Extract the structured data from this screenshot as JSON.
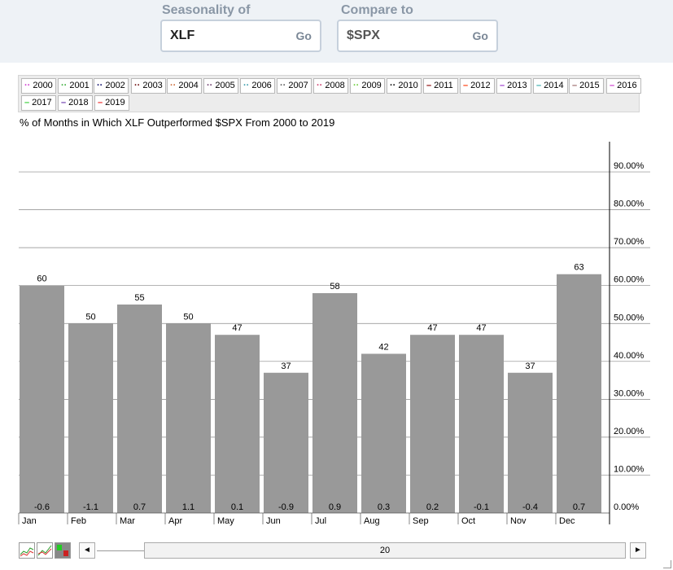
{
  "controls": {
    "seasonality_label": "Seasonality of",
    "seasonality_value": "XLF",
    "compare_label": "Compare to",
    "compare_value": "$SPX",
    "go_label": "Go"
  },
  "legend": [
    {
      "year": "2000",
      "color": "#cc33cc",
      "style": "dotted"
    },
    {
      "year": "2001",
      "color": "#33aa33",
      "style": "dotted"
    },
    {
      "year": "2002",
      "color": "#000066",
      "style": "dotted"
    },
    {
      "year": "2003",
      "color": "#660000",
      "style": "dotted"
    },
    {
      "year": "2004",
      "color": "#cc6633",
      "style": "dotted"
    },
    {
      "year": "2005",
      "color": "#663366",
      "style": "dotted"
    },
    {
      "year": "2006",
      "color": "#3399aa",
      "style": "dotted"
    },
    {
      "year": "2007",
      "color": "#555555",
      "style": "dotted"
    },
    {
      "year": "2008",
      "color": "#cc3366",
      "style": "dotted"
    },
    {
      "year": "2009",
      "color": "#66cc33",
      "style": "dotted"
    },
    {
      "year": "2010",
      "color": "#000000",
      "style": "dotted"
    },
    {
      "year": "2011",
      "color": "#880000",
      "style": "solid"
    },
    {
      "year": "2012",
      "color": "#ff3300",
      "style": "solid"
    },
    {
      "year": "2013",
      "color": "#9933cc",
      "style": "solid"
    },
    {
      "year": "2014",
      "color": "#33aaaa",
      "style": "solid"
    },
    {
      "year": "2015",
      "color": "#996666",
      "style": "solid"
    },
    {
      "year": "2016",
      "color": "#cc33cc",
      "style": "solid"
    },
    {
      "year": "2017",
      "color": "#33cc33",
      "style": "solid"
    },
    {
      "year": "2018",
      "color": "#6633aa",
      "style": "solid"
    },
    {
      "year": "2019",
      "color": "#ee2222",
      "style": "solid"
    }
  ],
  "chart_data": {
    "type": "bar",
    "title": "% of Months in Which XLF Outperformed $SPX From 2000 to 2019",
    "categories": [
      "Jan",
      "Feb",
      "Mar",
      "Apr",
      "May",
      "Jun",
      "Jul",
      "Aug",
      "Sep",
      "Oct",
      "Nov",
      "Dec"
    ],
    "values": [
      60,
      50,
      55,
      50,
      47,
      37,
      58,
      42,
      47,
      47,
      37,
      63
    ],
    "bottom_labels": [
      "-0.6",
      "-1.1",
      "0.7",
      "1.1",
      "0.1",
      "-0.9",
      "0.9",
      "0.3",
      "0.2",
      "-0.1",
      "-0.4",
      "0.7"
    ],
    "yticks": [
      "0.00%",
      "10.00%",
      "20.00%",
      "30.00%",
      "40.00%",
      "50.00%",
      "60.00%",
      "70.00%",
      "80.00%",
      "90.00%"
    ],
    "ylim": [
      0,
      100
    ],
    "bar_color": "#999999",
    "grid": true,
    "y_axis_position": "right"
  },
  "footer": {
    "range_value": "20",
    "left_arrow": "◄",
    "right_arrow": "►"
  }
}
